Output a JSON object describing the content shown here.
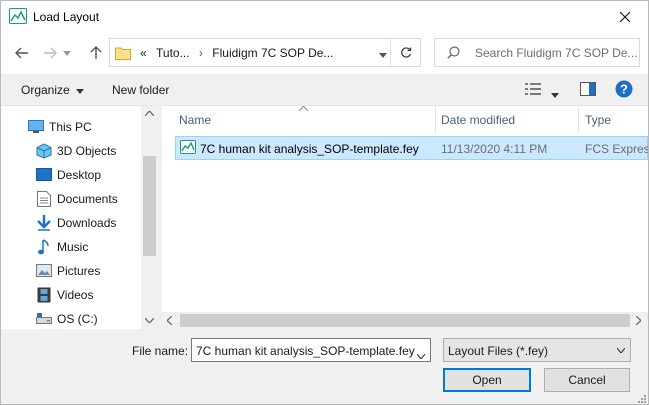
{
  "window": {
    "title": "Load Layout"
  },
  "address": {
    "crumb_1": "Tuto...",
    "crumb_2": "Fluidigm 7C SOP De...",
    "prefix": "«"
  },
  "search": {
    "placeholder": "Search Fluidigm 7C SOP De..."
  },
  "toolbar": {
    "organize": "Organize",
    "new_folder": "New folder"
  },
  "sidebar": {
    "items": [
      {
        "label": "This PC",
        "icon": "pc-icon"
      },
      {
        "label": "3D Objects",
        "icon": "cube-icon"
      },
      {
        "label": "Desktop",
        "icon": "desktop-icon"
      },
      {
        "label": "Documents",
        "icon": "documents-icon"
      },
      {
        "label": "Downloads",
        "icon": "download-icon"
      },
      {
        "label": "Music",
        "icon": "music-icon"
      },
      {
        "label": "Pictures",
        "icon": "pictures-icon"
      },
      {
        "label": "Videos",
        "icon": "videos-icon"
      },
      {
        "label": "OS (C:)",
        "icon": "drive-icon"
      }
    ]
  },
  "columns": {
    "name": "Name",
    "date": "Date modified",
    "type": "Type"
  },
  "files": [
    {
      "name": "7C human kit analysis_SOP-template.fey",
      "date": "11/13/2020 4:11 PM",
      "type": "FCS Express"
    }
  ],
  "bottom": {
    "file_name_label": "File name:",
    "file_name_value": "7C human kit analysis_SOP-template.fey",
    "filter": "Layout Files (*.fey)",
    "open": "Open",
    "cancel": "Cancel"
  },
  "colors": {
    "selection": "#cce8ff",
    "accent": "#0078d7",
    "header_text": "#4c607a"
  }
}
